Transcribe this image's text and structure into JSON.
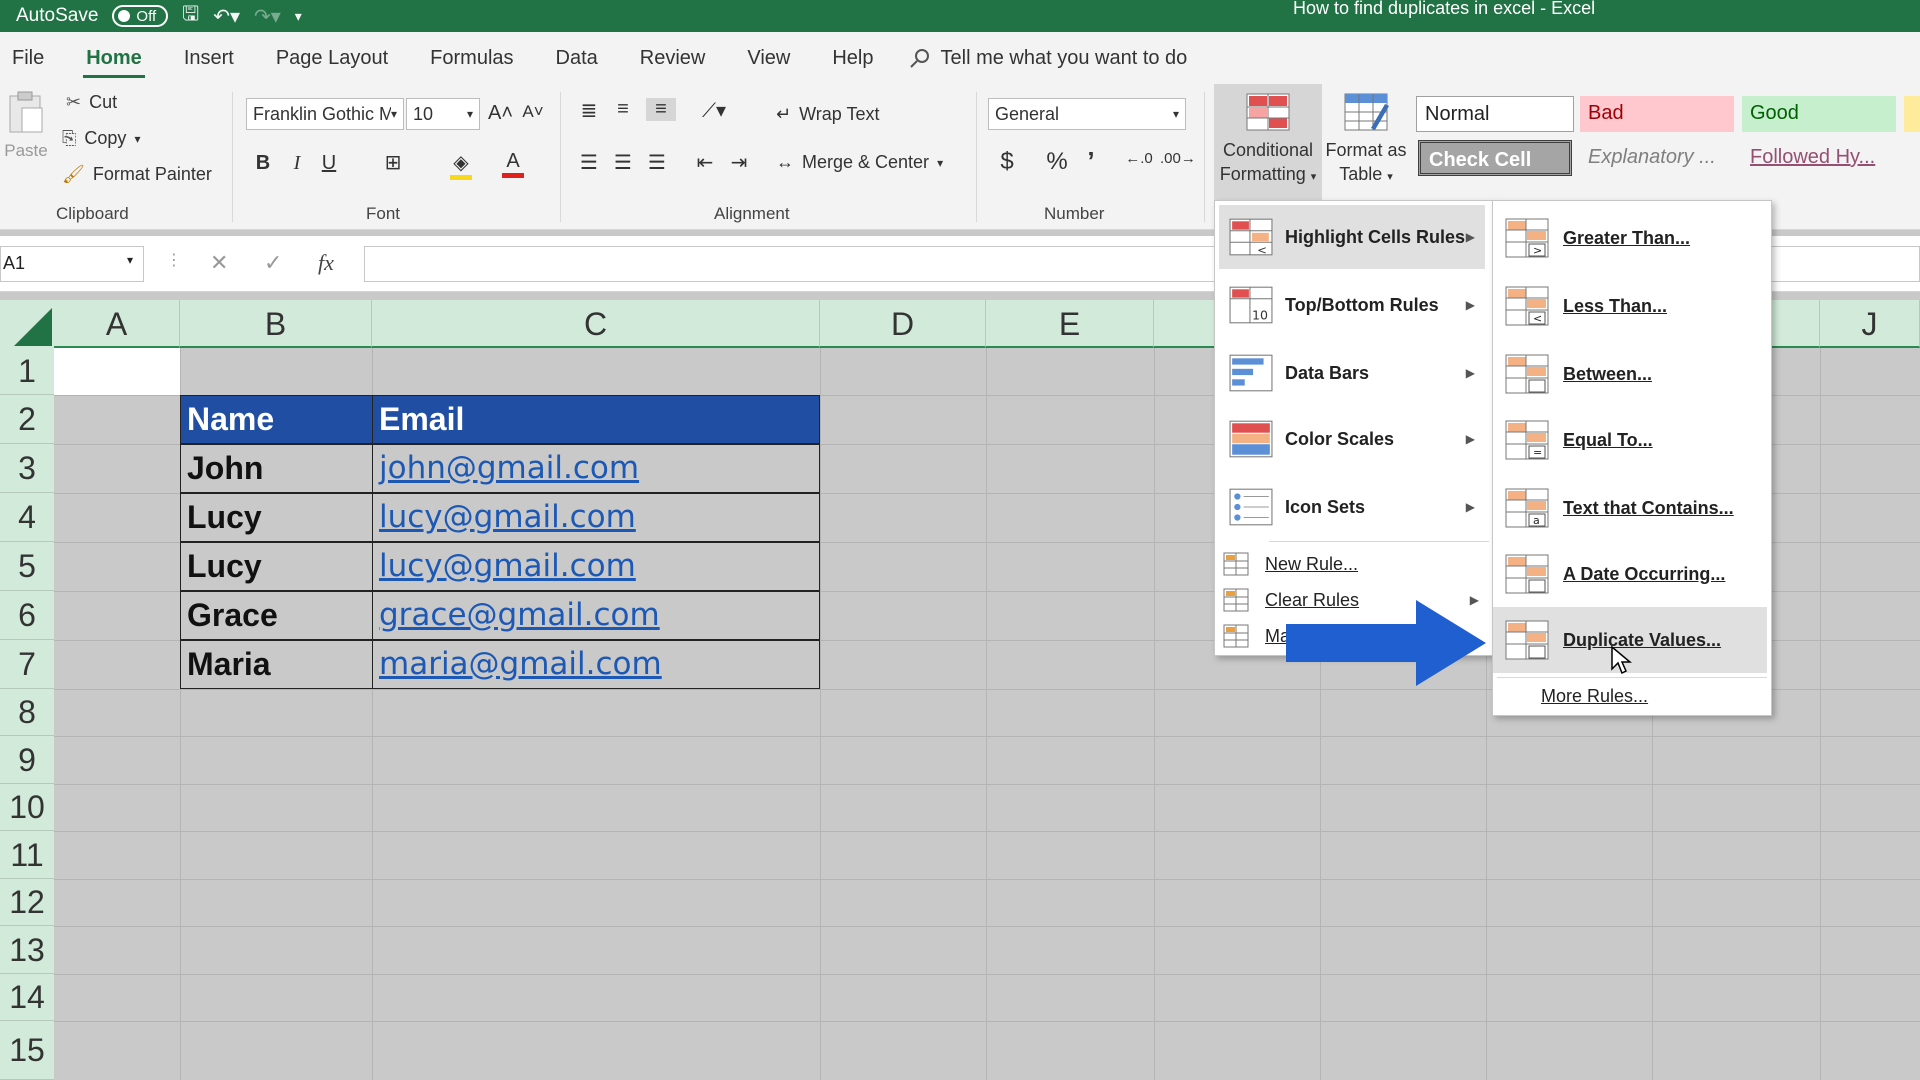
{
  "titlebar": {
    "autosave_label": "AutoSave",
    "autosave_state": "Off",
    "window_title": "How to find duplicates in excel  -  Excel"
  },
  "tabs": [
    "File",
    "Home",
    "Insert",
    "Page Layout",
    "Formulas",
    "Data",
    "Review",
    "View",
    "Help"
  ],
  "tell_me": "Tell me what you want to do",
  "ribbon": {
    "clipboard": {
      "label": "Clipboard",
      "paste": "Paste",
      "cut": "Cut",
      "copy": "Copy",
      "format_painter": "Format Painter"
    },
    "font": {
      "label": "Font",
      "family": "Franklin Gothic M",
      "size": "10"
    },
    "alignment": {
      "label": "Alignment",
      "wrap_text": "Wrap Text",
      "merge_center": "Merge & Center"
    },
    "number": {
      "label": "Number",
      "format": "General"
    },
    "styles": {
      "conditional_formatting": [
        "Conditional",
        "Formatting"
      ],
      "format_as_table": [
        "Format as",
        "Table"
      ],
      "cells": [
        {
          "text": "Normal",
          "bg": "#ffffff",
          "fg": "#222222"
        },
        {
          "text": "Bad",
          "bg": "#ffc7ce",
          "fg": "#9c0006"
        },
        {
          "text": "Good",
          "bg": "#c6efce",
          "fg": "#006100"
        },
        {
          "text": "Check Cell",
          "bg": "#a5a5a5",
          "fg": "#ffffff"
        },
        {
          "text": "Explanatory ...",
          "bg": "#f3f3f3",
          "fg": "#7f7f7f"
        },
        {
          "text": "Followed Hy...",
          "bg": "#f3f3f3",
          "fg": "#954f72"
        }
      ]
    }
  },
  "formula_bar": {
    "name_box": "A1",
    "fx": "fx"
  },
  "columns": [
    "A",
    "B",
    "C",
    "D",
    "E",
    "J"
  ],
  "rows": [
    "1",
    "2",
    "3",
    "4",
    "5",
    "6",
    "7",
    "8",
    "9",
    "10",
    "11",
    "12",
    "13",
    "14",
    "15"
  ],
  "table": {
    "headers": [
      "Name",
      "Email"
    ],
    "rows": [
      [
        "John",
        "john@gmail.com"
      ],
      [
        "Lucy",
        "lucy@gmail.com"
      ],
      [
        "Lucy",
        "lucy@gmail.com"
      ],
      [
        "Grace",
        "grace@gmail.com"
      ],
      [
        "Maria",
        "maria@gmail.com"
      ]
    ]
  },
  "cf_menu": {
    "items": [
      {
        "label": "Highlight Cells Rules",
        "icon": "highlight-cells-icon",
        "submenu": true,
        "active": true
      },
      {
        "label": "Top/Bottom Rules",
        "icon": "top-bottom-icon",
        "submenu": true
      },
      {
        "label": "Data Bars",
        "icon": "data-bars-icon",
        "submenu": true
      },
      {
        "label": "Color Scales",
        "icon": "color-scales-icon",
        "submenu": true
      },
      {
        "label": "Icon Sets",
        "icon": "icon-sets-icon",
        "submenu": true
      }
    ],
    "small_items": [
      {
        "label": "New Rule...",
        "submenu": false
      },
      {
        "label": "Clear Rules",
        "submenu": true
      },
      {
        "label": "Ma",
        "submenu": false
      }
    ]
  },
  "submenu": {
    "items": [
      {
        "label": "Greater Than...",
        "glyph": ">"
      },
      {
        "label": "Less Than...",
        "glyph": "<"
      },
      {
        "label": "Between...",
        "glyph": ""
      },
      {
        "label": "Equal To...",
        "glyph": "="
      },
      {
        "label": "Text that Contains...",
        "glyph": "a"
      },
      {
        "label": "A Date Occurring...",
        "glyph": ""
      },
      {
        "label": "Duplicate Values...",
        "glyph": "",
        "hover": true
      }
    ],
    "more": "More Rules..."
  },
  "colors": {
    "excel_green": "#217346",
    "header_fill": "#1f4ea3",
    "link": "#1c58b5",
    "arrow": "#1f5fcf"
  }
}
